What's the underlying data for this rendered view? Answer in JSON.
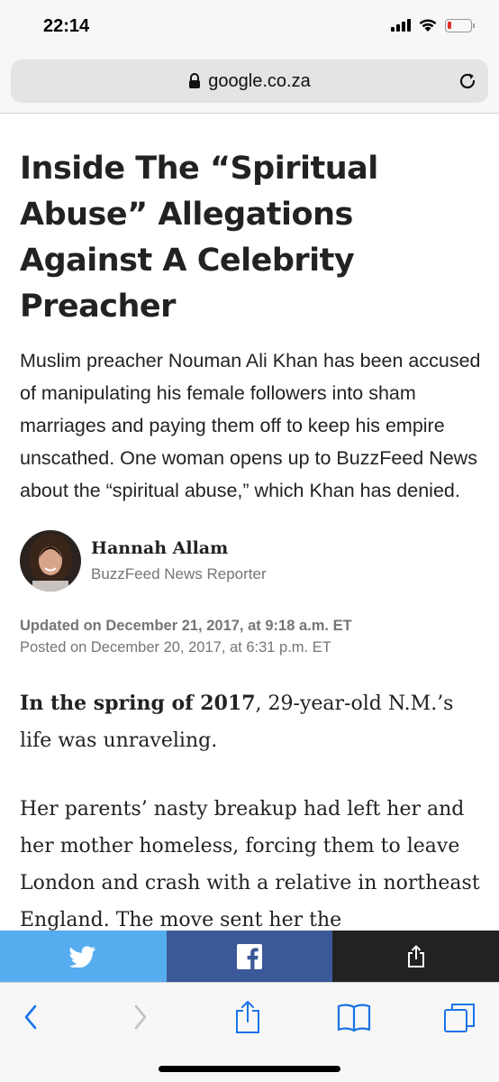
{
  "status_bar": {
    "time": "22:14",
    "icons": [
      "signal-icon",
      "wifi-icon",
      "battery-low-icon"
    ],
    "battery_color": "#e0342c"
  },
  "browser": {
    "url": "google.co.za",
    "icons": [
      "lock-icon",
      "reload-icon"
    ]
  },
  "article": {
    "headline": "Inside The “Spiritual Abuse” Allegations Against A Celebrity Preacher",
    "dek": "Muslim preacher Nouman Ali Khan has been accused of manipulating his female followers into sham marriages and paying them off to keep his empire unscathed. One woman opens up to BuzzFeed News about the “spiritual abuse,” which Khan has denied.",
    "author": {
      "name": "Hannah Allam",
      "role": "BuzzFeed News Reporter"
    },
    "updated": "Updated on December 21, 2017, at 9:18 a.m. ET",
    "posted": "Posted on December 20, 2017, at 6:31 p.m. ET",
    "paragraph1_lead": "In the spring of 2017",
    "paragraph1_rest": ", 29-year-old N.M.’s life was unraveling.",
    "paragraph2": "Her parents’ nasty breakup had left her and her mother homeless, forcing them to leave London and crash with a relative in northeast England. The move sent her the"
  },
  "share_bar": {
    "buttons": [
      "twitter-icon",
      "facebook-icon",
      "share-icon"
    ],
    "colors": {
      "twitter": "#55acee",
      "facebook": "#3b5998",
      "more": "#222222"
    }
  },
  "toolbar": {
    "buttons": [
      "back-icon",
      "forward-icon",
      "share-icon",
      "bookmarks-icon",
      "tabs-icon"
    ],
    "accent": "#1a73e8"
  }
}
